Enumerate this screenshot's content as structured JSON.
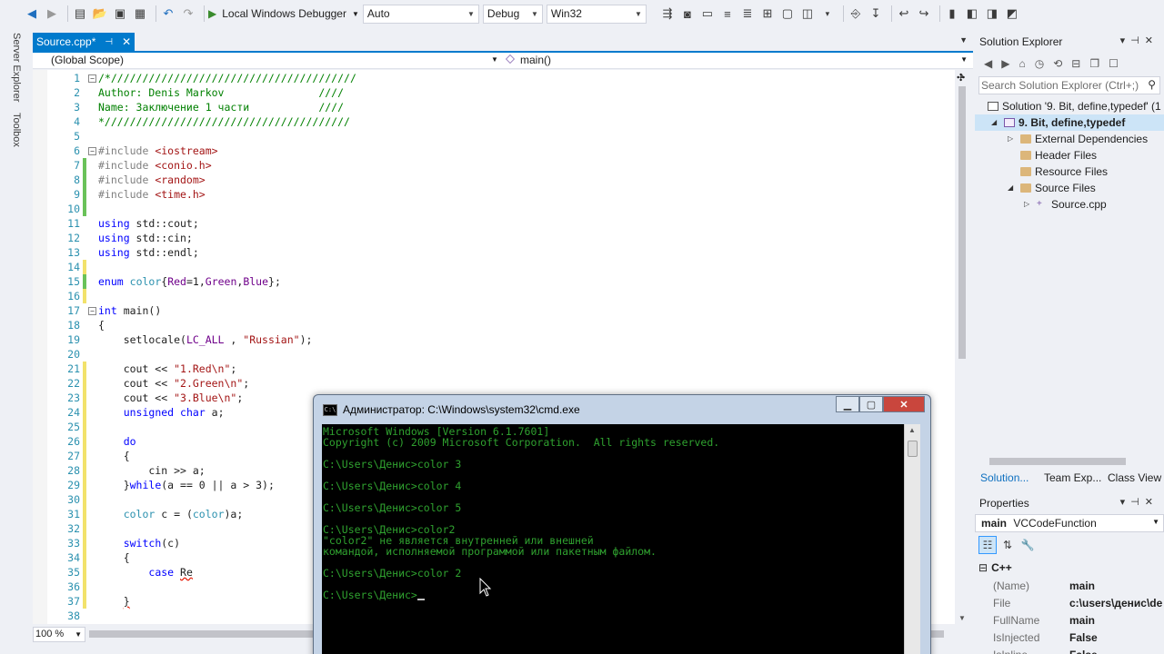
{
  "toolbar": {
    "debugger_label": "Local Windows Debugger",
    "auto_value": "Auto",
    "config_value": "Debug",
    "platform_value": "Win32"
  },
  "left_rail": {
    "server_explorer": "Server Explorer",
    "toolbox": "Toolbox"
  },
  "editor": {
    "tab_label": "Source.cpp*",
    "scope": "(Global Scope)",
    "member": "main()",
    "zoom": "100 %",
    "lines": [
      {
        "n": "1",
        "segs": [
          {
            "t": "/*///////////////////////////////////////",
            "c": "cm"
          }
        ]
      },
      {
        "n": "2",
        "segs": [
          {
            "t": "Author: Denis Markov               ////",
            "c": "cm"
          }
        ]
      },
      {
        "n": "3",
        "segs": [
          {
            "t": "Name: Заключение 1 части           ////",
            "c": "cm"
          }
        ]
      },
      {
        "n": "4",
        "segs": [
          {
            "t": "*///////////////////////////////////////",
            "c": "cm"
          }
        ]
      },
      {
        "n": "5",
        "segs": []
      },
      {
        "n": "6",
        "segs": [
          {
            "t": "#include ",
            "c": "pp"
          },
          {
            "t": "<iostream>",
            "c": "st"
          }
        ]
      },
      {
        "n": "7",
        "segs": [
          {
            "t": "#include ",
            "c": "pp"
          },
          {
            "t": "<conio.h>",
            "c": "st"
          }
        ]
      },
      {
        "n": "8",
        "segs": [
          {
            "t": "#include ",
            "c": "pp"
          },
          {
            "t": "<random>",
            "c": "st"
          }
        ]
      },
      {
        "n": "9",
        "segs": [
          {
            "t": "#include ",
            "c": "pp"
          },
          {
            "t": "<time.h>",
            "c": "st"
          }
        ]
      },
      {
        "n": "10",
        "segs": []
      },
      {
        "n": "11",
        "segs": [
          {
            "t": "using",
            "c": "kw"
          },
          {
            "t": " std::cout;",
            "c": ""
          }
        ]
      },
      {
        "n": "12",
        "segs": [
          {
            "t": "using",
            "c": "kw"
          },
          {
            "t": " std::cin;",
            "c": ""
          }
        ]
      },
      {
        "n": "13",
        "segs": [
          {
            "t": "using",
            "c": "kw"
          },
          {
            "t": " std::endl;",
            "c": ""
          }
        ]
      },
      {
        "n": "14",
        "segs": []
      },
      {
        "n": "15",
        "segs": [
          {
            "t": "enum",
            "c": "kw"
          },
          {
            "t": " ",
            "c": ""
          },
          {
            "t": "color",
            "c": "ty"
          },
          {
            "t": "{",
            "c": ""
          },
          {
            "t": "Red",
            "c": "mc"
          },
          {
            "t": "=1,",
            "c": ""
          },
          {
            "t": "Green",
            "c": "mc"
          },
          {
            "t": ",",
            "c": ""
          },
          {
            "t": "Blue",
            "c": "mc"
          },
          {
            "t": "};",
            "c": ""
          }
        ]
      },
      {
        "n": "16",
        "segs": []
      },
      {
        "n": "17",
        "segs": [
          {
            "t": "int",
            "c": "kw"
          },
          {
            "t": " main()",
            "c": ""
          }
        ]
      },
      {
        "n": "18",
        "segs": [
          {
            "t": "{",
            "c": ""
          }
        ]
      },
      {
        "n": "19",
        "segs": [
          {
            "t": "    setlocale(",
            "c": ""
          },
          {
            "t": "LC_ALL",
            "c": "mc"
          },
          {
            "t": " , ",
            "c": ""
          },
          {
            "t": "\"Russian\"",
            "c": "st"
          },
          {
            "t": ");",
            "c": ""
          }
        ]
      },
      {
        "n": "20",
        "segs": []
      },
      {
        "n": "21",
        "segs": [
          {
            "t": "    cout << ",
            "c": ""
          },
          {
            "t": "\"1.Red\\n\"",
            "c": "st"
          },
          {
            "t": ";",
            "c": ""
          }
        ]
      },
      {
        "n": "22",
        "segs": [
          {
            "t": "    cout << ",
            "c": ""
          },
          {
            "t": "\"2.Green\\n\"",
            "c": "st"
          },
          {
            "t": ";",
            "c": ""
          }
        ]
      },
      {
        "n": "23",
        "segs": [
          {
            "t": "    cout << ",
            "c": ""
          },
          {
            "t": "\"3.Blue\\n\"",
            "c": "st"
          },
          {
            "t": ";",
            "c": ""
          }
        ]
      },
      {
        "n": "24",
        "segs": [
          {
            "t": "    ",
            "c": ""
          },
          {
            "t": "unsigned",
            "c": "kw"
          },
          {
            "t": " ",
            "c": ""
          },
          {
            "t": "char",
            "c": "kw"
          },
          {
            "t": " a;",
            "c": ""
          }
        ]
      },
      {
        "n": "25",
        "segs": []
      },
      {
        "n": "26",
        "segs": [
          {
            "t": "    ",
            "c": ""
          },
          {
            "t": "do",
            "c": "kw"
          }
        ]
      },
      {
        "n": "27",
        "segs": [
          {
            "t": "    {",
            "c": ""
          }
        ]
      },
      {
        "n": "28",
        "segs": [
          {
            "t": "        cin >> a;",
            "c": ""
          }
        ]
      },
      {
        "n": "29",
        "segs": [
          {
            "t": "    }",
            "c": ""
          },
          {
            "t": "while",
            "c": "kw"
          },
          {
            "t": "(a == 0 || a > 3);",
            "c": ""
          }
        ]
      },
      {
        "n": "30",
        "segs": []
      },
      {
        "n": "31",
        "segs": [
          {
            "t": "    ",
            "c": ""
          },
          {
            "t": "color",
            "c": "ty"
          },
          {
            "t": " c = (",
            "c": ""
          },
          {
            "t": "color",
            "c": "ty"
          },
          {
            "t": ")a;",
            "c": ""
          }
        ]
      },
      {
        "n": "32",
        "segs": []
      },
      {
        "n": "33",
        "segs": [
          {
            "t": "    ",
            "c": ""
          },
          {
            "t": "switch",
            "c": "kw"
          },
          {
            "t": "(c)",
            "c": ""
          }
        ]
      },
      {
        "n": "34",
        "segs": [
          {
            "t": "    {",
            "c": ""
          }
        ]
      },
      {
        "n": "35",
        "segs": [
          {
            "t": "        ",
            "c": ""
          },
          {
            "t": "case",
            "c": "kw"
          },
          {
            "t": " ",
            "c": ""
          },
          {
            "t": "Re",
            "c": "sq"
          }
        ]
      },
      {
        "n": "36",
        "segs": []
      },
      {
        "n": "37",
        "segs": [
          {
            "t": "    ",
            "c": ""
          },
          {
            "t": "}",
            "c": "sq"
          }
        ]
      },
      {
        "n": "38",
        "segs": []
      }
    ]
  },
  "solution_explorer": {
    "title": "Solution Explorer",
    "search_placeholder": "Search Solution Explorer (Ctrl+;)",
    "items": [
      {
        "label": "Solution '9. Bit, define,typedef' (1",
        "kind": "sol",
        "level": 0,
        "exp": ""
      },
      {
        "label": "9. Bit, define,typedef",
        "kind": "proj",
        "level": 1,
        "exp": "◢",
        "selected": true,
        "bold": true
      },
      {
        "label": "External Dependencies",
        "kind": "folder",
        "level": 2,
        "exp": "▷"
      },
      {
        "label": "Header Files",
        "kind": "folder",
        "level": 2,
        "exp": ""
      },
      {
        "label": "Resource Files",
        "kind": "folder",
        "level": 2,
        "exp": ""
      },
      {
        "label": "Source Files",
        "kind": "folder",
        "level": 2,
        "exp": "◢"
      },
      {
        "label": "Source.cpp",
        "kind": "cpp",
        "level": 3,
        "exp": "▷"
      }
    ],
    "tabs": [
      "Solution...",
      "Team Exp...",
      "Class View"
    ]
  },
  "properties": {
    "title": "Properties",
    "object_name": "main",
    "object_type": "VCCodeFunction",
    "category": "C++",
    "rows": [
      {
        "k": "(Name)",
        "v": "main"
      },
      {
        "k": "File",
        "v": "c:\\users\\денис\\de"
      },
      {
        "k": "FullName",
        "v": "main"
      },
      {
        "k": "IsInjected",
        "v": "False"
      },
      {
        "k": "IsInline",
        "v": "False"
      }
    ]
  },
  "cmd": {
    "title": "Администратор: C:\\Windows\\system32\\cmd.exe",
    "lines": [
      "Microsoft Windows [Version 6.1.7601]",
      "Copyright (c) 2009 Microsoft Corporation.  All rights reserved.",
      "",
      "C:\\Users\\Денис>color 3",
      "",
      "C:\\Users\\Денис>color 4",
      "",
      "C:\\Users\\Денис>color 5",
      "",
      "C:\\Users\\Денис>color2",
      "\"color2\" не является внутренней или внешней",
      "командой, исполняемой программой или пакетным файлом.",
      "",
      "C:\\Users\\Денис>color 2",
      "",
      "C:\\Users\\Денис>"
    ]
  }
}
